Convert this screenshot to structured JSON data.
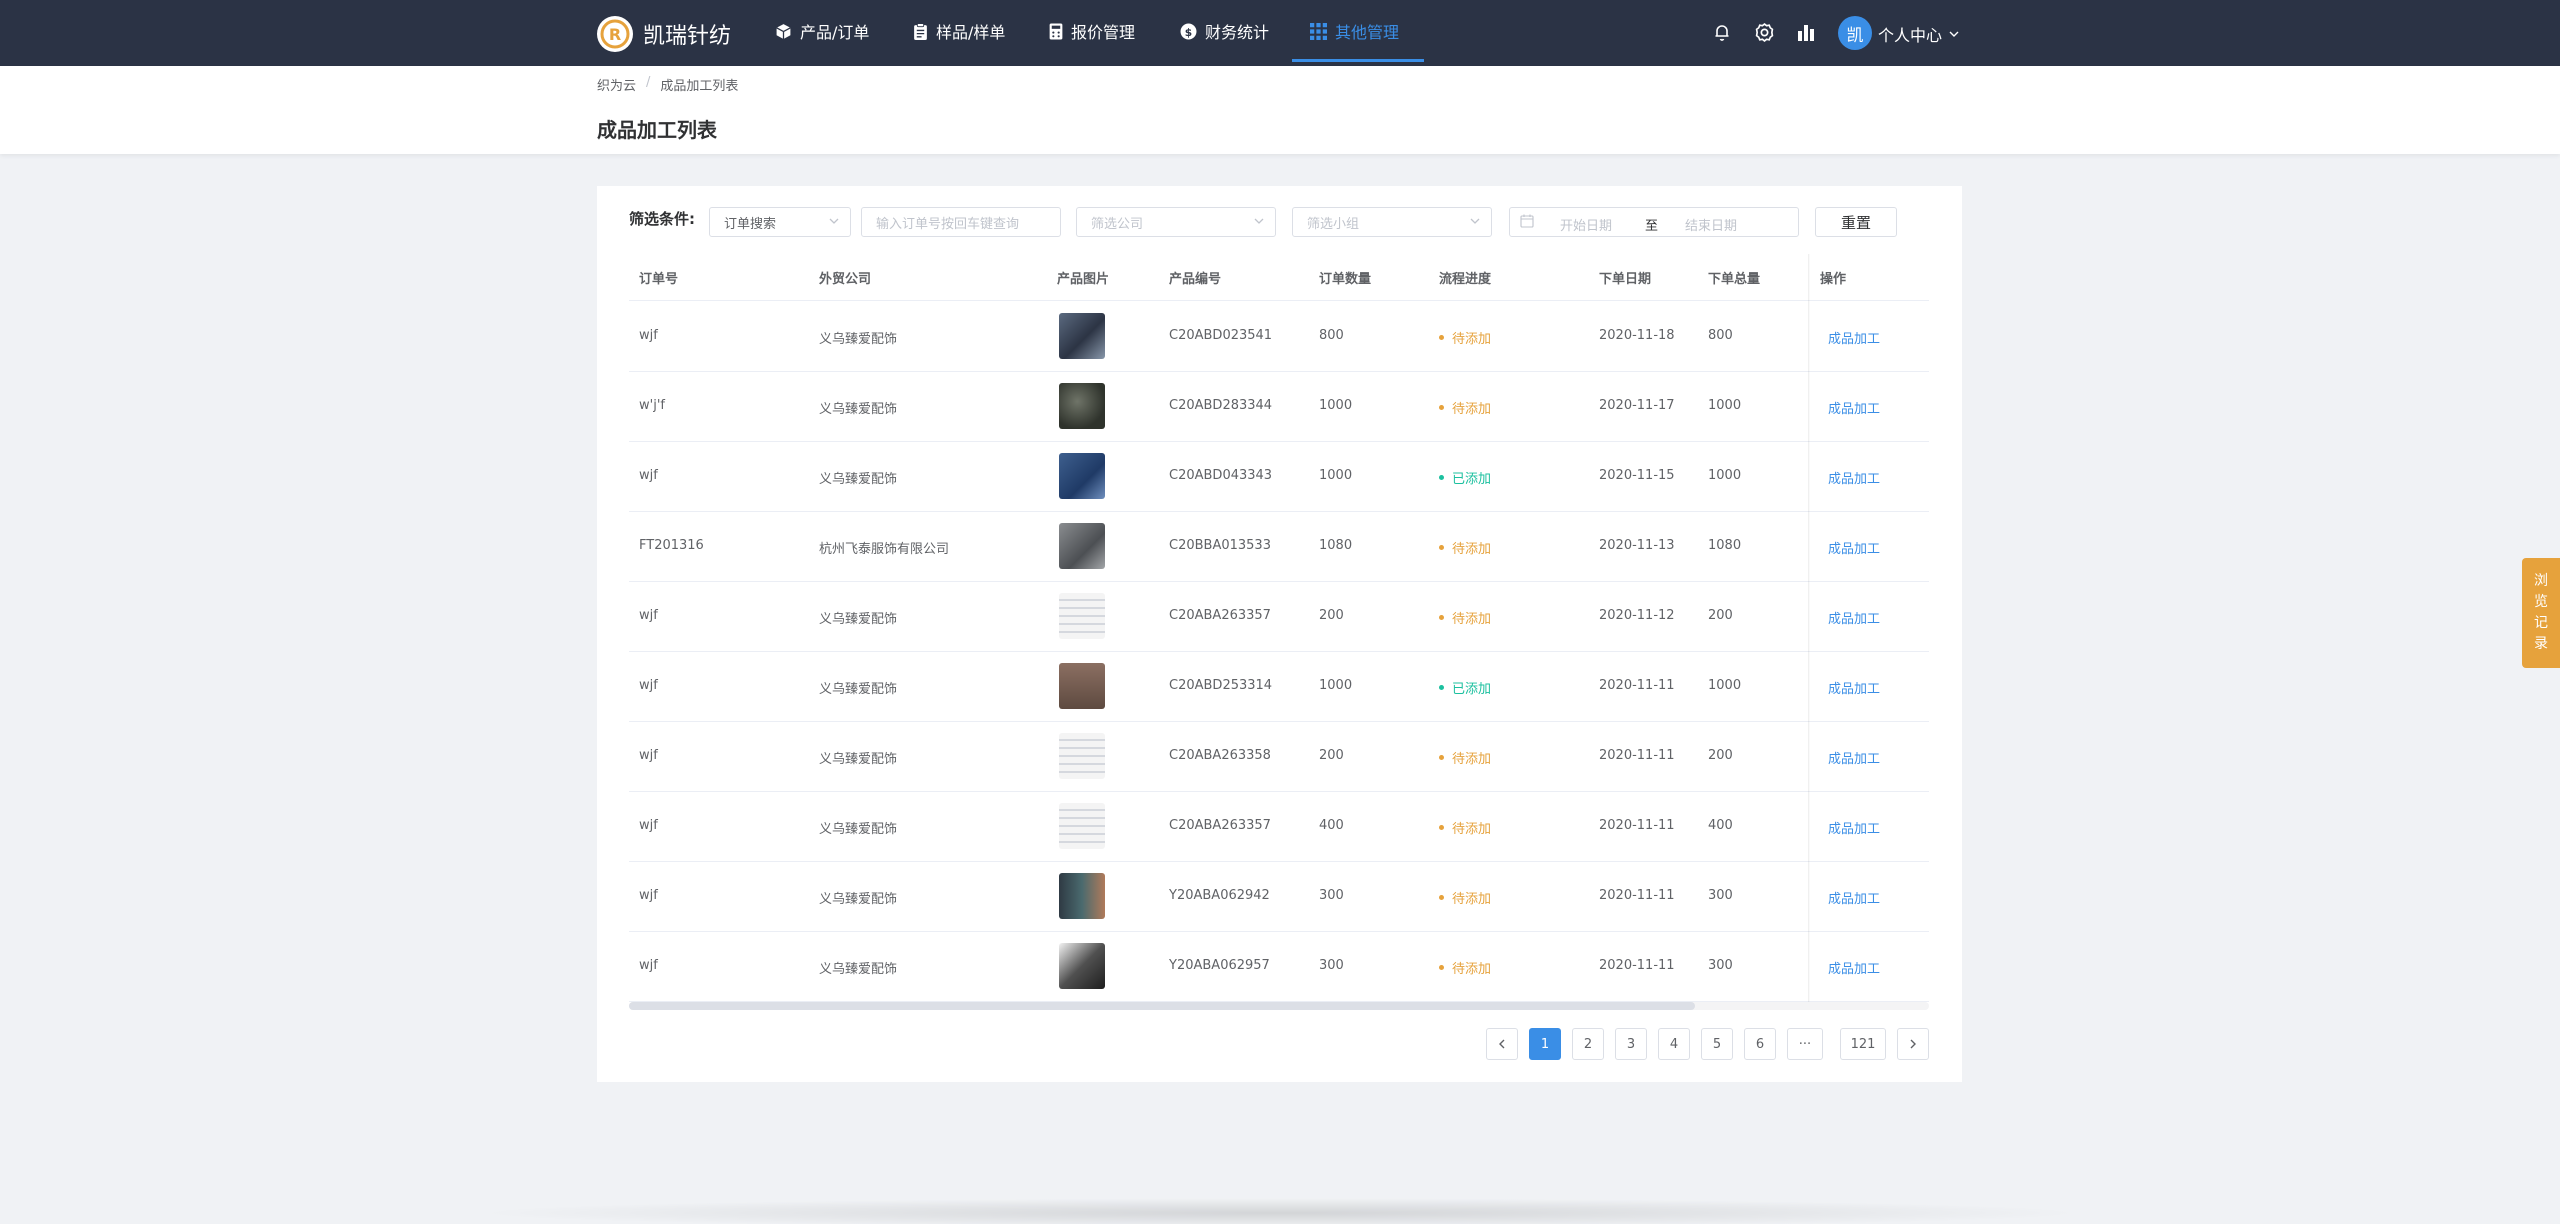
{
  "brand": {
    "name": "凯瑞针纺"
  },
  "nav": [
    {
      "label": "产品/订单",
      "icon": "cube-icon"
    },
    {
      "label": "样品/样单",
      "icon": "clipboard-icon"
    },
    {
      "label": "报价管理",
      "icon": "calculator-icon"
    },
    {
      "label": "财务统计",
      "icon": "dollar-circle-icon"
    },
    {
      "label": "其他管理",
      "icon": "grid-icon",
      "active": true
    }
  ],
  "user": {
    "avatar_char": "凯",
    "menu_label": "个人中心"
  },
  "breadcrumb": [
    "织为云",
    "成品加工列表"
  ],
  "page_title": "成品加工列表",
  "filters": {
    "label": "筛选条件:",
    "search_type": "订单搜索",
    "order_input_placeholder": "输入订单号按回车键查询",
    "company_placeholder": "筛选公司",
    "group_placeholder": "筛选小组",
    "start_date_placeholder": "开始日期",
    "date_separator": "至",
    "end_date_placeholder": "结束日期",
    "reset_label": "重置"
  },
  "table": {
    "columns": [
      "订单号",
      "外贸公司",
      "产品图片",
      "产品编号",
      "订单数量",
      "流程进度",
      "下单日期",
      "下单总量",
      "操作"
    ],
    "rows": [
      {
        "order_no": "wjf",
        "company": "义乌臻爱配饰",
        "product_code": "C20ABD023541",
        "quantity": "800",
        "status": "待添加",
        "date": "2020-11-18",
        "total": "800",
        "action": "成品加工"
      },
      {
        "order_no": "w'j'f",
        "company": "义乌臻爱配饰",
        "product_code": "C20ABD283344",
        "quantity": "1000",
        "status": "待添加",
        "date": "2020-11-17",
        "total": "1000",
        "action": "成品加工"
      },
      {
        "order_no": "wjf",
        "company": "义乌臻爱配饰",
        "product_code": "C20ABD043343",
        "quantity": "1000",
        "status": "已添加",
        "date": "2020-11-15",
        "total": "1000",
        "action": "成品加工"
      },
      {
        "order_no": "FT201316",
        "company": "杭州飞泰服饰有限公司",
        "product_code": "C20BBA013533",
        "quantity": "1080",
        "status": "待添加",
        "date": "2020-11-13",
        "total": "1080",
        "action": "成品加工"
      },
      {
        "order_no": "wjf",
        "company": "义乌臻爱配饰",
        "product_code": "C20ABA263357",
        "quantity": "200",
        "status": "待添加",
        "date": "2020-11-12",
        "total": "200",
        "action": "成品加工"
      },
      {
        "order_no": "wjf",
        "company": "义乌臻爱配饰",
        "product_code": "C20ABD253314",
        "quantity": "1000",
        "status": "已添加",
        "date": "2020-11-11",
        "total": "1000",
        "action": "成品加工"
      },
      {
        "order_no": "wjf",
        "company": "义乌臻爱配饰",
        "product_code": "C20ABA263358",
        "quantity": "200",
        "status": "待添加",
        "date": "2020-11-11",
        "total": "200",
        "action": "成品加工"
      },
      {
        "order_no": "wjf",
        "company": "义乌臻爱配饰",
        "product_code": "C20ABA263357",
        "quantity": "400",
        "status": "待添加",
        "date": "2020-11-11",
        "total": "400",
        "action": "成品加工"
      },
      {
        "order_no": "wjf",
        "company": "义乌臻爱配饰",
        "product_code": "Y20ABA062942",
        "quantity": "300",
        "status": "待添加",
        "date": "2020-11-11",
        "total": "300",
        "action": "成品加工"
      },
      {
        "order_no": "wjf",
        "company": "义乌臻爱配饰",
        "product_code": "Y20ABA062957",
        "quantity": "300",
        "status": "待添加",
        "date": "2020-11-11",
        "total": "300",
        "action": "成品加工"
      }
    ]
  },
  "pagination": {
    "pages": [
      "1",
      "2",
      "3",
      "4",
      "5",
      "6"
    ],
    "ellipsis": "···",
    "last": "121",
    "current": "1"
  },
  "side_tab": {
    "label": "浏览记录"
  },
  "colors": {
    "nav_bg": "#2b3345",
    "accent": "#3a8ee6",
    "pending": "#e6a23c",
    "added": "#1cc09f"
  }
}
